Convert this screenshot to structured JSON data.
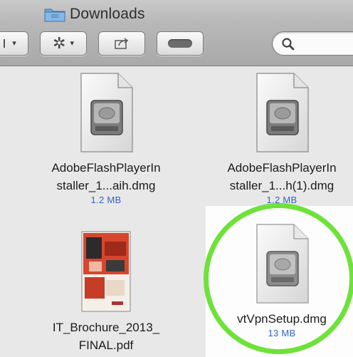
{
  "window": {
    "title": "Downloads",
    "folder_icon": "folder-icon"
  },
  "toolbar": {
    "view_caret": "▾",
    "action_caret": "▾",
    "icons": [
      "view-options-icon",
      "gear-icon",
      "share-icon",
      "label-icon",
      "search-icon"
    ]
  },
  "search": {
    "placeholder": ""
  },
  "files": [
    {
      "name_line1": "AdobeFlashPlayerIn",
      "name_line2": "staller_1...aih.dmg",
      "size": "1.2 MB",
      "icon": "disk-image-icon"
    },
    {
      "name_line1": "AdobeFlashPlayerIn",
      "name_line2": "staller_1...h(1).dmg",
      "size": "1.2 MB",
      "icon": "disk-image-icon"
    },
    {
      "name_line1": "IT_Brochure_2013_",
      "name_line2": "FINAL.pdf",
      "size": "",
      "icon": "pdf-thumbnail-icon"
    },
    {
      "name_line1": "vtVpnSetup.dmg",
      "size": "13 MB",
      "icon": "disk-image-icon",
      "selected": true
    }
  ],
  "colors": {
    "highlight_ring": "#6ee23a",
    "size_text": "#2f64c9"
  }
}
